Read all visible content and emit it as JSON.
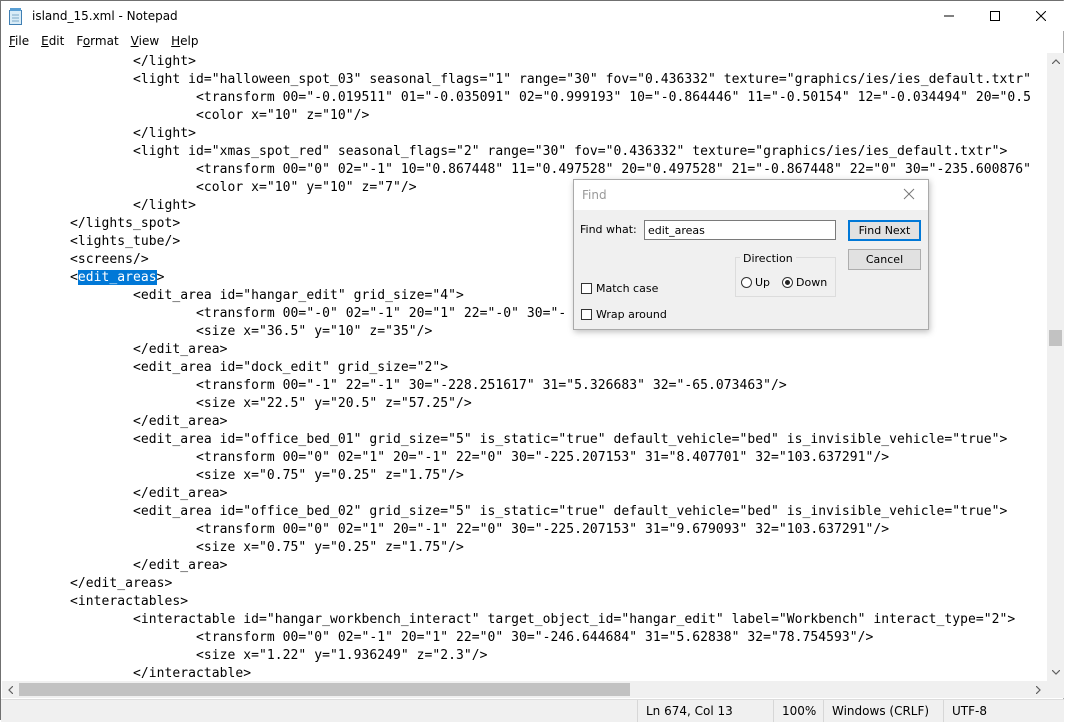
{
  "window": {
    "title": "island_15.xml - Notepad"
  },
  "menu": [
    {
      "accel": "F",
      "rest": "ile"
    },
    {
      "accel": "E",
      "rest": "dit"
    },
    {
      "accel": "",
      "rest": "F",
      "after": "o",
      "tail": "rmat"
    },
    {
      "accel": "V",
      "rest": "iew"
    },
    {
      "accel": "H",
      "rest": "elp"
    }
  ],
  "menu_labels": [
    "File",
    "Edit",
    "Format",
    "View",
    "Help"
  ],
  "editor": {
    "lines": [
      "\t\t</light>",
      "\t\t<light id=\"halloween_spot_03\" seasonal_flags=\"1\" range=\"30\" fov=\"0.436332\" texture=\"graphics/ies/ies_default.txtr\"",
      "\t\t\t<transform 00=\"-0.019511\" 01=\"-0.035091\" 02=\"0.999193\" 10=\"-0.864446\" 11=\"-0.50154\" 12=\"-0.034494\" 20=\"0.5",
      "\t\t\t<color x=\"10\" z=\"10\"/>",
      "\t\t</light>",
      "\t\t<light id=\"xmas_spot_red\" seasonal_flags=\"2\" range=\"30\" fov=\"0.436332\" texture=\"graphics/ies/ies_default.txtr\">",
      "\t\t\t<transform 00=\"0\" 02=\"-1\" 10=\"0.867448\" 11=\"0.497528\" 20=\"0.497528\" 21=\"-0.867448\" 22=\"0\" 30=\"-235.600876\"",
      "\t\t\t<color x=\"10\" y=\"10\" z=\"7\"/>",
      "\t\t</light>",
      "\t</lights_spot>",
      "\t<lights_tube/>",
      "\t<screens/>",
      "\t<edit_areas>",
      "\t\t<edit_area id=\"hangar_edit\" grid_size=\"4\">",
      "\t\t\t<transform 00=\"-0\" 02=\"-1\" 20=\"1\" 22=\"-0\" 30=\"-",
      "\t\t\t<size x=\"36.5\" y=\"10\" z=\"35\"/>",
      "\t\t</edit_area>",
      "\t\t<edit_area id=\"dock_edit\" grid_size=\"2\">",
      "\t\t\t<transform 00=\"-1\" 22=\"-1\" 30=\"-228.251617\" 31=\"5.326683\" 32=\"-65.073463\"/>",
      "\t\t\t<size x=\"22.5\" y=\"20.5\" z=\"57.25\"/>",
      "\t\t</edit_area>",
      "\t\t<edit_area id=\"office_bed_01\" grid_size=\"5\" is_static=\"true\" default_vehicle=\"bed\" is_invisible_vehicle=\"true\">",
      "\t\t\t<transform 00=\"0\" 02=\"1\" 20=\"-1\" 22=\"0\" 30=\"-225.207153\" 31=\"8.407701\" 32=\"103.637291\"/>",
      "\t\t\t<size x=\"0.75\" y=\"0.25\" z=\"1.75\"/>",
      "\t\t</edit_area>",
      "\t\t<edit_area id=\"office_bed_02\" grid_size=\"5\" is_static=\"true\" default_vehicle=\"bed\" is_invisible_vehicle=\"true\">",
      "\t\t\t<transform 00=\"0\" 02=\"1\" 20=\"-1\" 22=\"0\" 30=\"-225.207153\" 31=\"9.679093\" 32=\"103.637291\"/>",
      "\t\t\t<size x=\"0.75\" y=\"0.25\" z=\"1.75\"/>",
      "\t\t</edit_area>",
      "\t</edit_areas>",
      "\t<interactables>",
      "\t\t<interactable id=\"hangar_workbench_interact\" target_object_id=\"hangar_edit\" label=\"Workbench\" interact_type=\"2\">",
      "\t\t\t<transform 00=\"0\" 02=\"-1\" 20=\"1\" 22=\"0\" 30=\"-246.644684\" 31=\"5.62838\" 32=\"78.754593\"/>",
      "\t\t\t<size x=\"1.22\" y=\"1.936249\" z=\"2.3\"/>",
      "\t\t</interactable>"
    ],
    "highlight": {
      "line": 12,
      "text": "edit_areas"
    }
  },
  "statusbar": {
    "position": "Ln 674, Col 13",
    "zoom": "100%",
    "line_ending": "Windows (CRLF)",
    "encoding": "UTF-8"
  },
  "find_dialog": {
    "title": "Find",
    "find_what_label": "Find what:",
    "find_what_value": "edit_areas",
    "find_next_label": "Find Next",
    "cancel_label": "Cancel",
    "direction_label": "Direction",
    "up_label": "Up",
    "down_label": "Down",
    "selected_direction": "down",
    "match_case_label": "Match case",
    "match_case_checked": false,
    "wrap_around_label": "Wrap around",
    "wrap_around_checked": false
  }
}
